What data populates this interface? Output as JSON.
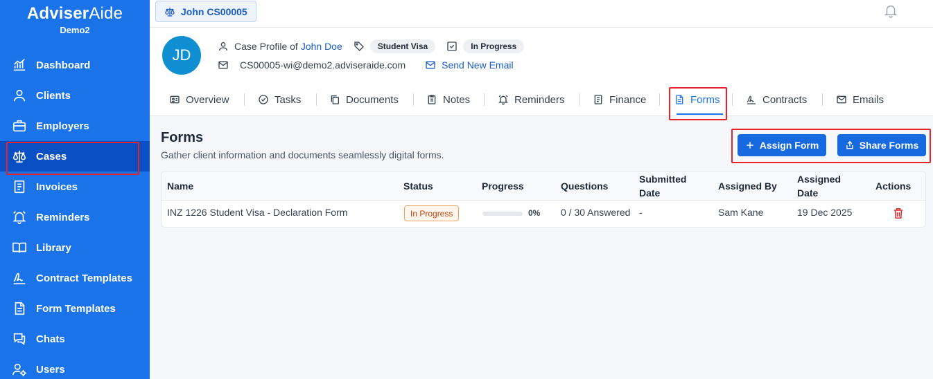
{
  "brand": {
    "name_bold": "Adviser",
    "name_thin": "Aide",
    "tenant": "Demo2"
  },
  "sidebar": {
    "items": [
      {
        "label": "Dashboard",
        "icon": "chart-icon"
      },
      {
        "label": "Clients",
        "icon": "user-icon"
      },
      {
        "label": "Employers",
        "icon": "briefcase-icon"
      },
      {
        "label": "Cases",
        "icon": "scale-icon",
        "active": true
      },
      {
        "label": "Invoices",
        "icon": "invoice-icon"
      },
      {
        "label": "Reminders",
        "icon": "bell-icon"
      },
      {
        "label": "Library",
        "icon": "book-icon"
      },
      {
        "label": "Contract Templates",
        "icon": "signature-icon"
      },
      {
        "label": "Form Templates",
        "icon": "document-icon"
      },
      {
        "label": "Chats",
        "icon": "chat-icon"
      },
      {
        "label": "Users",
        "icon": "users-gear-icon"
      }
    ]
  },
  "topbar": {
    "case_chip": "John CS00005",
    "bell_icon": "bell-icon"
  },
  "profile": {
    "initials": "JD",
    "case_profile_prefix": "Case Profile of",
    "client_name": "John Doe",
    "visa_tag": "Student Visa",
    "status_tag": "In Progress",
    "email": "CS00005-wi@demo2.adviseraide.com",
    "send_email": "Send New Email"
  },
  "tabs": [
    {
      "label": "Overview",
      "icon": "id-card-icon"
    },
    {
      "label": "Tasks",
      "icon": "check-circle-icon"
    },
    {
      "label": "Documents",
      "icon": "copy-icon"
    },
    {
      "label": "Notes",
      "icon": "clipboard-icon"
    },
    {
      "label": "Reminders",
      "icon": "alarm-icon"
    },
    {
      "label": "Finance",
      "icon": "receipt-icon"
    },
    {
      "label": "Forms",
      "icon": "file-icon",
      "active": true
    },
    {
      "label": "Contracts",
      "icon": "signature-icon"
    },
    {
      "label": "Emails",
      "icon": "mail-icon"
    }
  ],
  "main": {
    "title": "Forms",
    "subtitle": "Gather client information and documents seamlessly digital forms.",
    "assign_form": "Assign Form",
    "share_forms": "Share Forms"
  },
  "table": {
    "headers": {
      "name": "Name",
      "status": "Status",
      "progress": "Progress",
      "questions": "Questions",
      "submitted_1": "Submitted",
      "submitted_2": "Date",
      "assigned_by": "Assigned By",
      "assigned_1": "Assigned",
      "assigned_2": "Date",
      "actions": "Actions"
    },
    "rows": [
      {
        "name": "INZ 1226 Student Visa - Declaration Form",
        "status": "In Progress",
        "progress": 0,
        "progress_label": "0%",
        "questions": "0 / 30 Answered",
        "submitted_date": "-",
        "assigned_by": "Sam Kane",
        "assigned_date": "19 Dec 2025"
      }
    ]
  },
  "colors": {
    "primary": "#1a73e8",
    "sidebar_active": "#0b4fc4",
    "highlight": "#e5232b",
    "delete": "#dc2626"
  }
}
